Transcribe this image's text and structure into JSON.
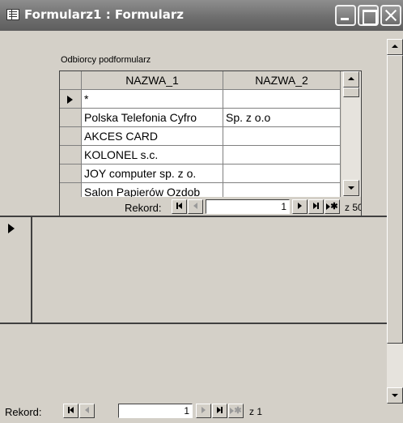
{
  "window": {
    "title": "Formularz1 : Formularz"
  },
  "subform": {
    "label": "Odbiorcy podformularz",
    "columns": [
      "NAZWA_1",
      "NAZWA_2"
    ],
    "new_row_marker": "*",
    "rows": [
      {
        "nazwa_1": "Polska Telefonia Cyfro",
        "nazwa_2": "Sp. z o.o"
      },
      {
        "nazwa_1": "AKCES CARD",
        "nazwa_2": ""
      },
      {
        "nazwa_1": "KOLONEL s.c.",
        "nazwa_2": ""
      },
      {
        "nazwa_1": "JOY computer sp. z o.",
        "nazwa_2": ""
      },
      {
        "nazwa_1": "Salon Papierów Ozdob",
        "nazwa_2": ""
      }
    ],
    "navigator": {
      "label": "Rekord:",
      "current": "1",
      "of_text": "z 50"
    }
  },
  "main_navigator": {
    "label": "Rekord:",
    "current": "1",
    "of_text": "z 1"
  },
  "icons": {
    "window": "form-window-icon",
    "minimize": "minimize-icon",
    "maximize": "maximize-icon",
    "close": "close-icon"
  }
}
